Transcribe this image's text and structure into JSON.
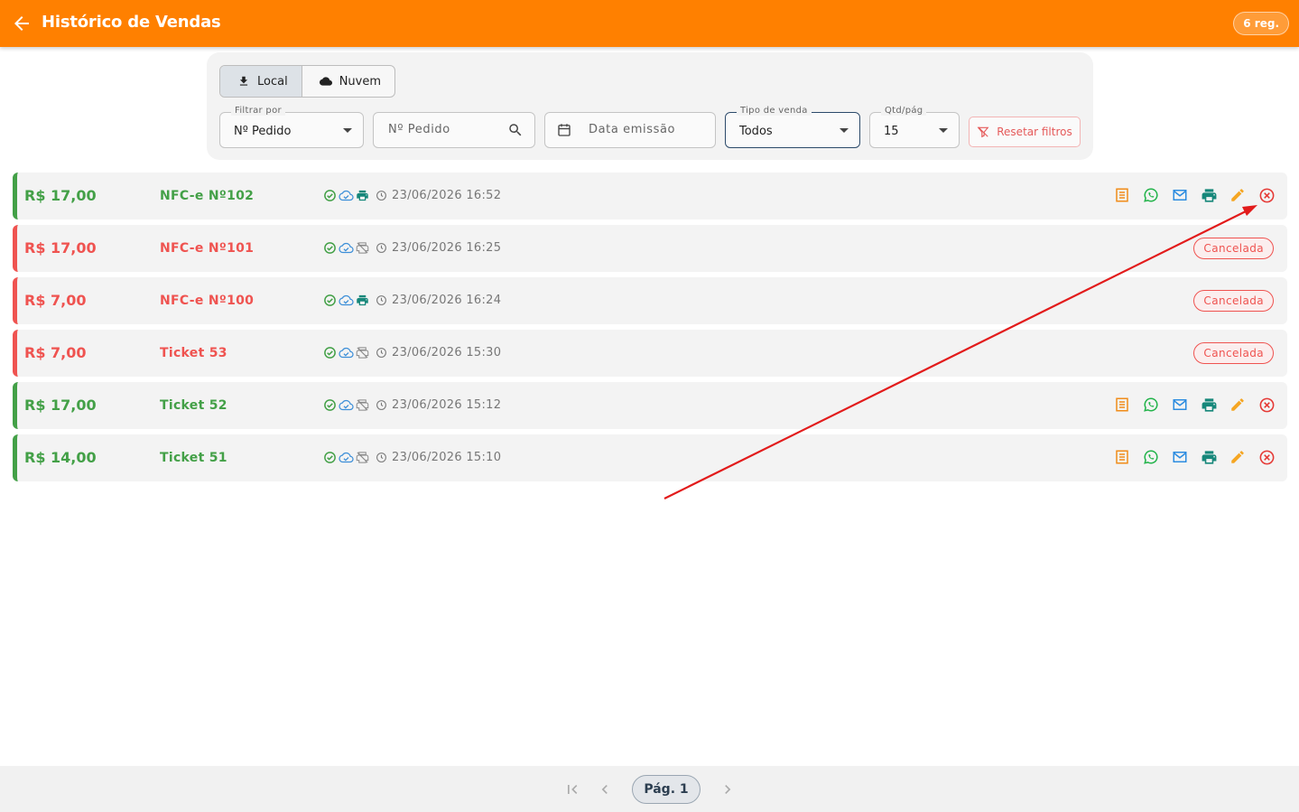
{
  "header": {
    "title": "Histórico de Vendas",
    "records_badge": "6 reg.",
    "background_color": "#ff8000"
  },
  "source_toggle": {
    "local_label": "Local",
    "cloud_label": "Nuvem",
    "selected": "Local"
  },
  "filters": {
    "filter_by": {
      "label": "Filtrar por",
      "value": "Nº Pedido"
    },
    "search": {
      "placeholder": "Nº Pedido"
    },
    "date": {
      "placeholder": "Data emissão"
    },
    "sale_type": {
      "label": "Tipo de venda",
      "value": "Todos"
    },
    "per_page": {
      "label": "Qtd/pág",
      "value": "15"
    },
    "reset_label": "Resetar filtros"
  },
  "sales": [
    {
      "amount": "R$ 17,00",
      "doc": "NFC-e Nº102",
      "datetime": "23/06/2026 16:52",
      "status": "ok",
      "printed": true,
      "cancel_label": ""
    },
    {
      "amount": "R$ 17,00",
      "doc": "NFC-e Nº101",
      "datetime": "23/06/2026 16:25",
      "status": "cancelada",
      "printed": false,
      "cancel_label": "Cancelada"
    },
    {
      "amount": "R$ 7,00",
      "doc": "NFC-e Nº100",
      "datetime": "23/06/2026 16:24",
      "status": "cancelada",
      "printed": true,
      "cancel_label": "Cancelada"
    },
    {
      "amount": "R$ 7,00",
      "doc": "Ticket 53",
      "datetime": "23/06/2026 15:30",
      "status": "cancelada",
      "printed": false,
      "cancel_label": "Cancelada"
    },
    {
      "amount": "R$ 17,00",
      "doc": "Ticket 52",
      "datetime": "23/06/2026 15:12",
      "status": "ok",
      "printed": false,
      "cancel_label": ""
    },
    {
      "amount": "R$ 14,00",
      "doc": "Ticket 51",
      "datetime": "23/06/2026 15:10",
      "status": "ok",
      "printed": false,
      "cancel_label": ""
    }
  ],
  "row_actions": [
    "receipt-icon",
    "whatsapp-icon",
    "email-icon",
    "print-icon",
    "edit-icon",
    "cancel-icon"
  ],
  "pagination": {
    "label": "Pág. 1"
  },
  "colors": {
    "ok": "#43a047",
    "cancelled": "#ef5350",
    "annotation": "#e21b1b"
  }
}
